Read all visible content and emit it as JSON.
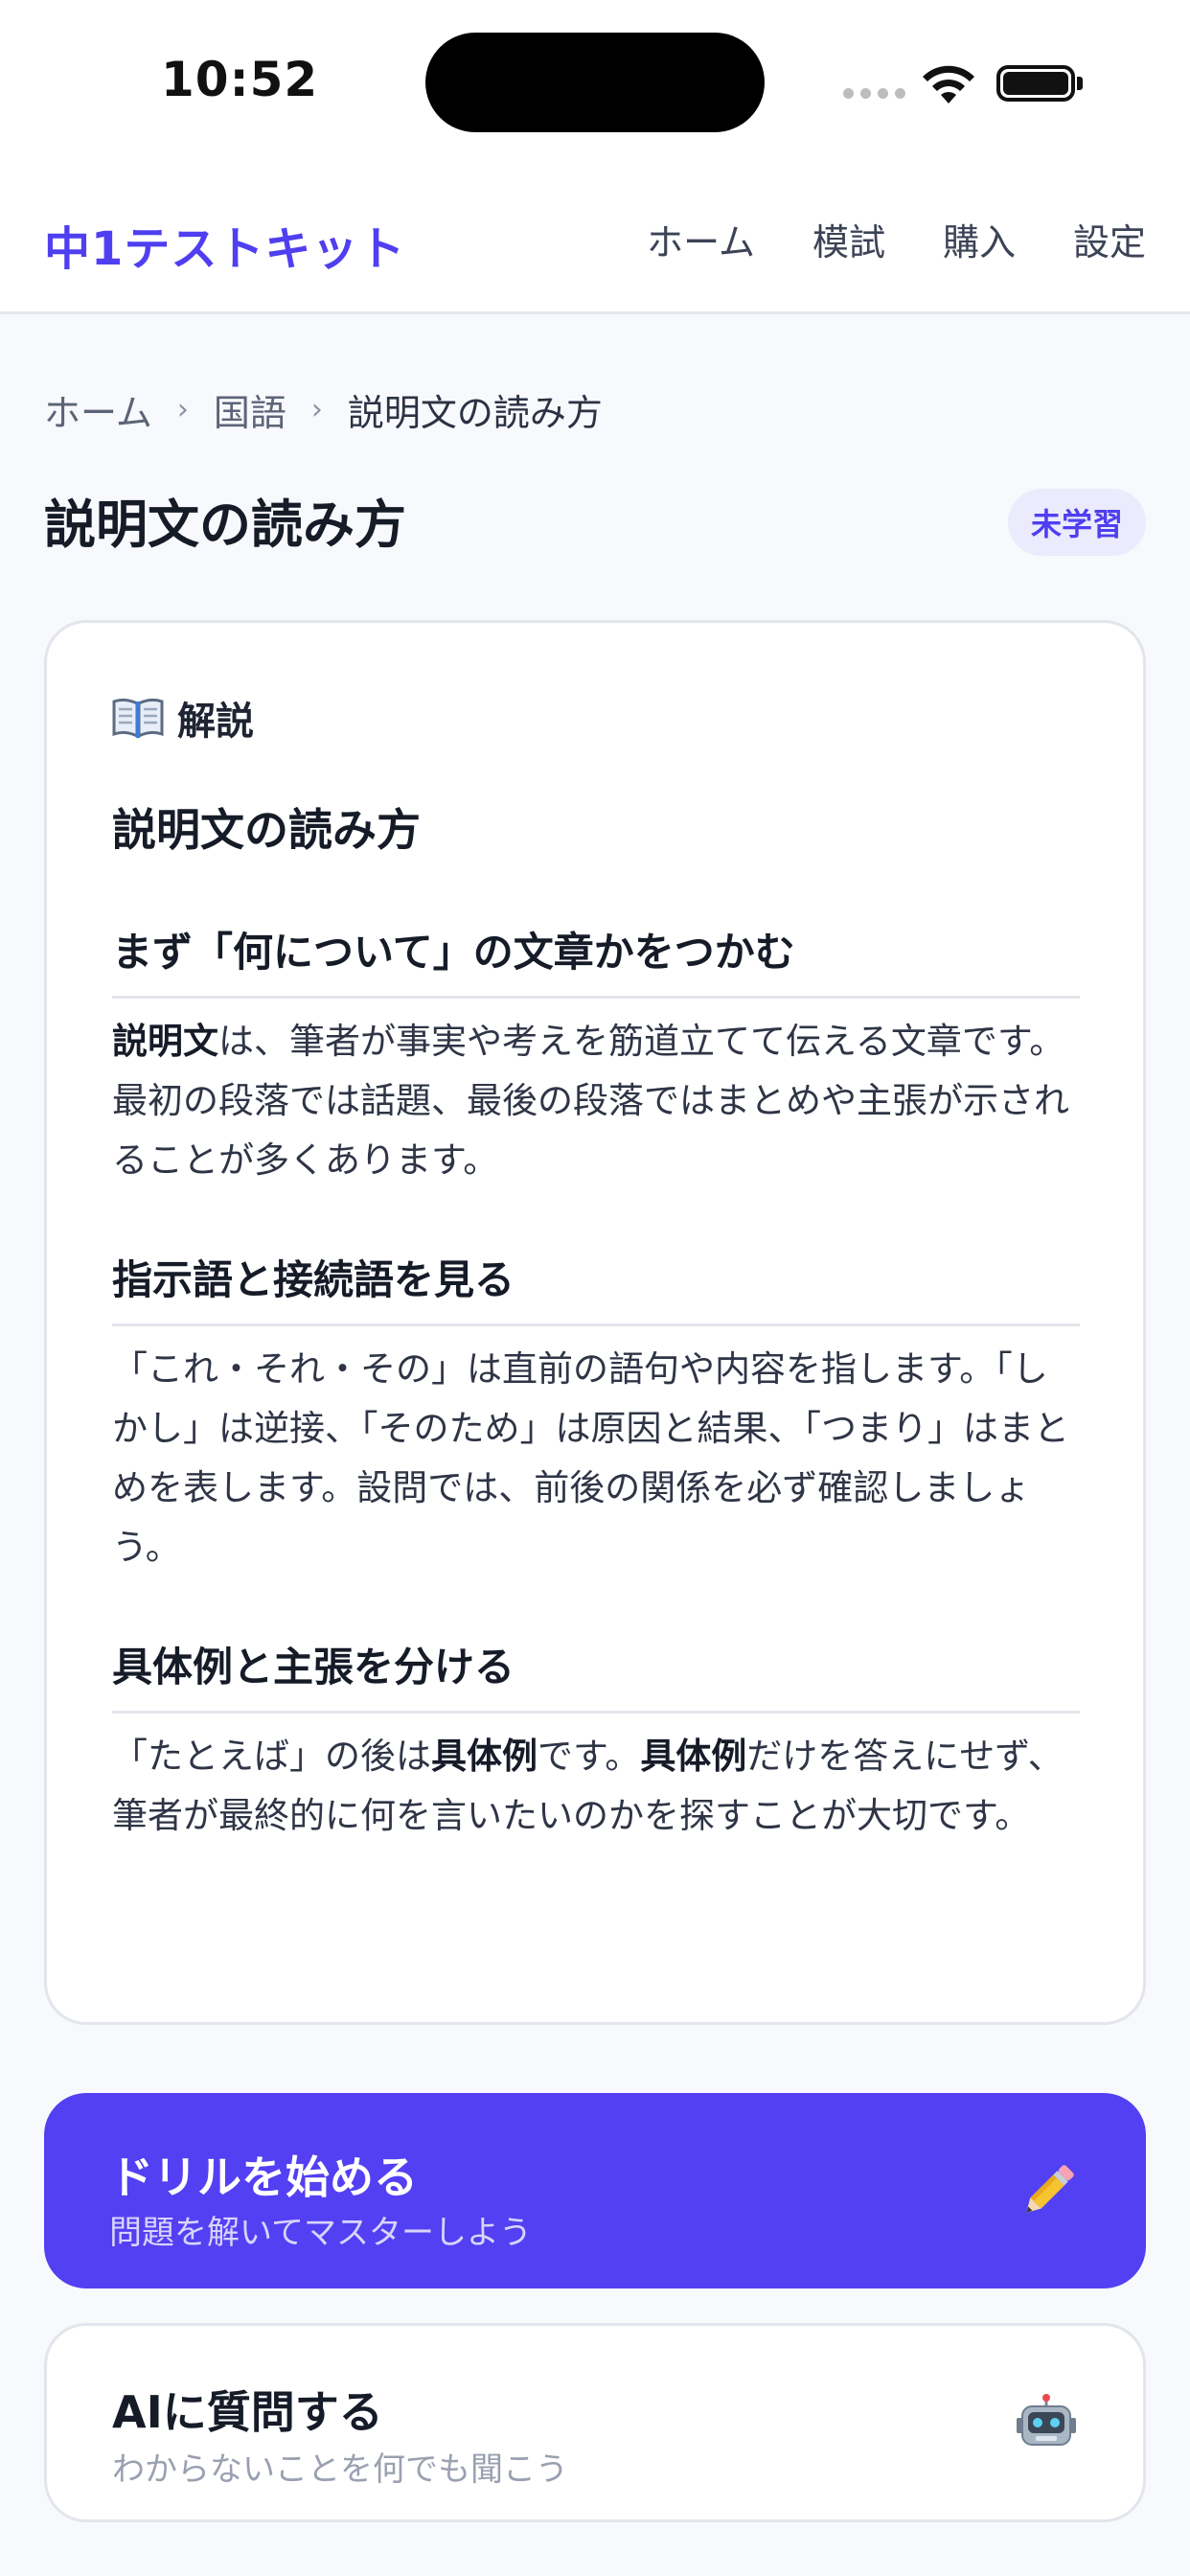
{
  "status_bar": {
    "time": "10:52"
  },
  "header": {
    "app_title": "中1テストキット",
    "nav": [
      {
        "label": "ホーム"
      },
      {
        "label": "模試"
      },
      {
        "label": "購入"
      },
      {
        "label": "設定"
      }
    ]
  },
  "breadcrumb": [
    "ホーム",
    "国語",
    "説明文の読み方"
  ],
  "page": {
    "title": "説明文の読み方",
    "status_badge": "未学習"
  },
  "explanation": {
    "label": "解説",
    "title": "説明文の読み方",
    "sections": [
      {
        "heading": "まず「何について」の文章かをつかむ",
        "term": "説明文",
        "body": "は、筆者が事実や考えを筋道立てて伝える文章です。最初の段落では話題、最後の段落ではまとめや主張が示されることが多くあります。"
      },
      {
        "heading": "指示語と接続語を見る",
        "body": "「これ・それ・その」は直前の語句や内容を指します。「しかし」は逆接、「そのため」は原因と結果、「つまり」はまとめを表します。設問では、前後の関係を必ず確認しましょう。"
      },
      {
        "heading": "具体例と主張を分ける",
        "body_part1": "「たとえば」の後は",
        "term1": "具体例",
        "body_part2": "です。",
        "term2": "具体例",
        "body_part3": "だけを答えにせず、筆者が最終的に何を言いたいのかを探すことが大切です。"
      }
    ]
  },
  "drill_button": {
    "title": "ドリルを始める",
    "subtitle": "問題を解いてマスターしよう",
    "icon": "pencil-icon"
  },
  "ai_button": {
    "title": "AIに質問する",
    "subtitle": "わからないことを何でも聞こう",
    "icon": "robot-icon"
  },
  "colors": {
    "accent": "#5340f2",
    "brand_text": "#4f3ff0",
    "badge_bg": "#ecebfd"
  }
}
